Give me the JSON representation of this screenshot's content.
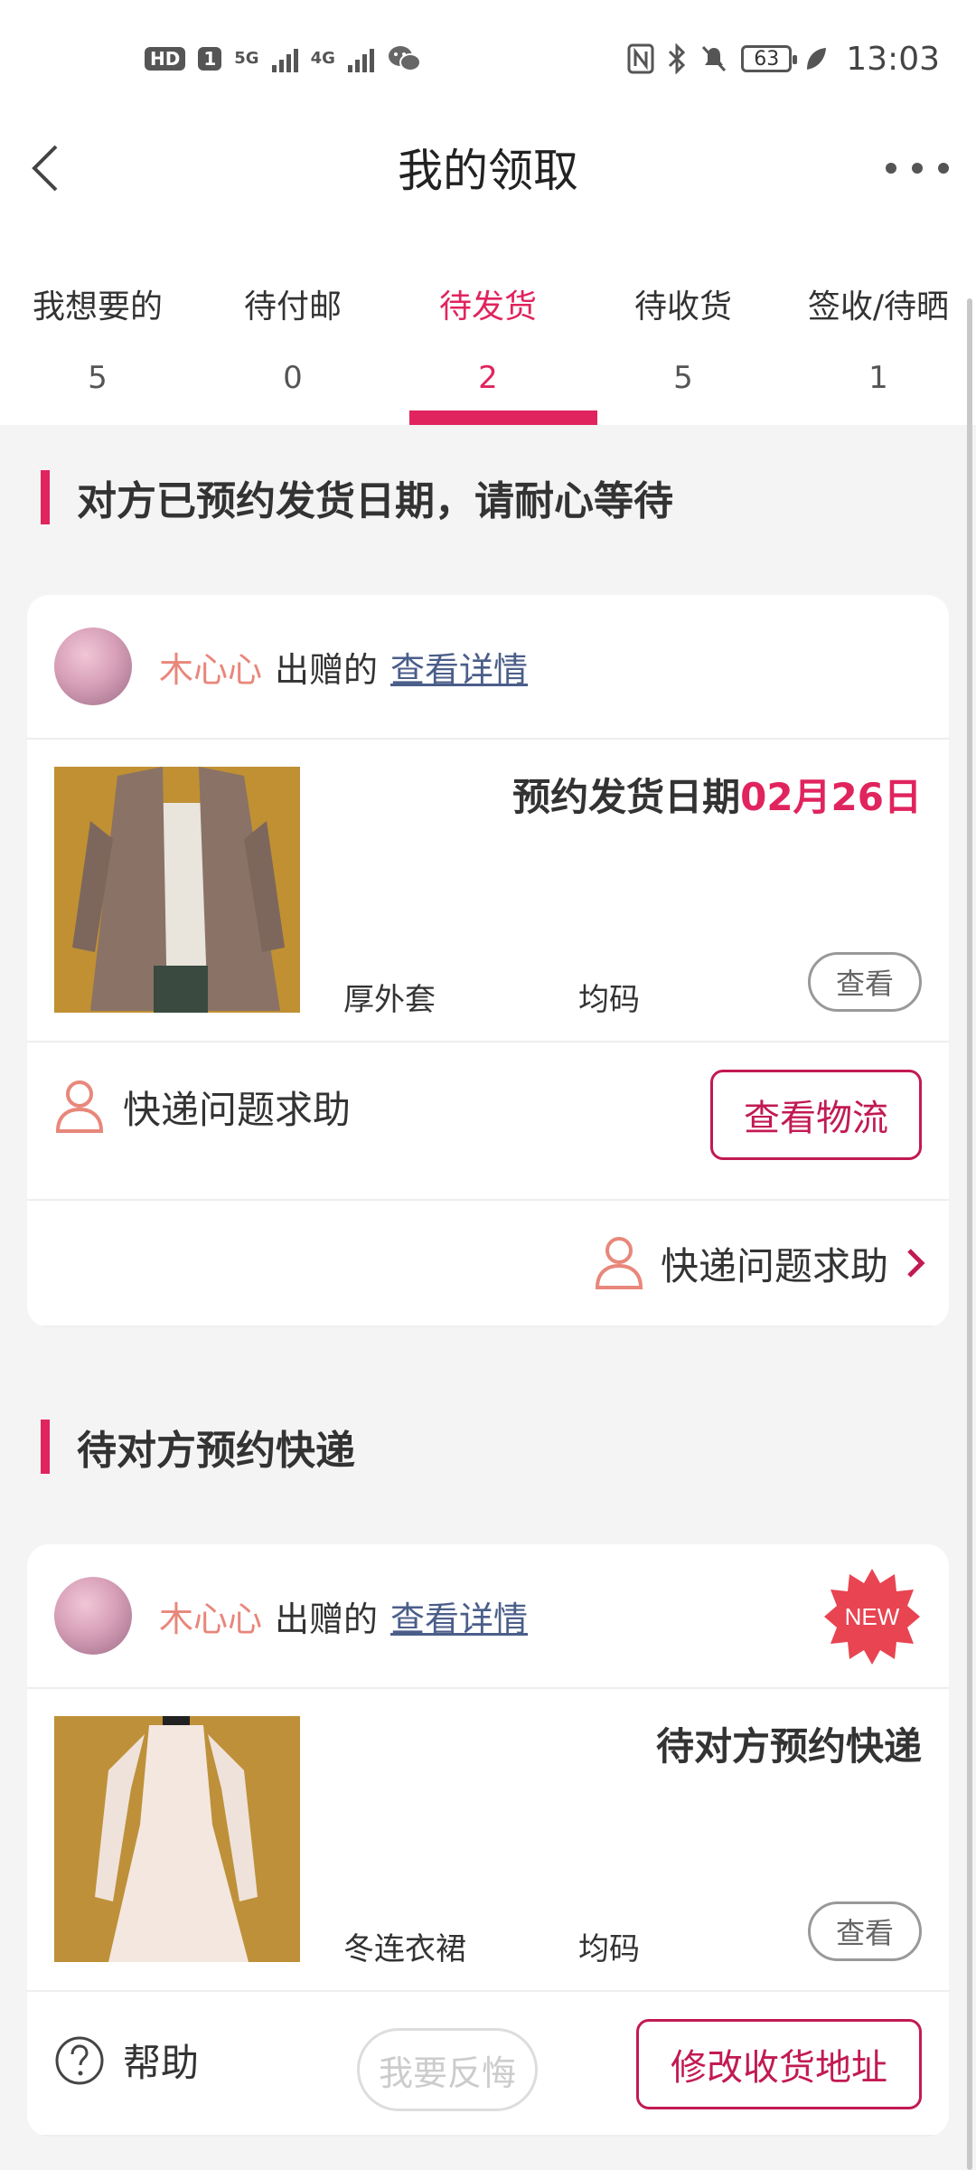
{
  "status_bar": {
    "hd": "HD",
    "sim": "1",
    "net1": "5G",
    "net2": "4G",
    "battery": "63",
    "time": "13:03"
  },
  "header": {
    "title": "我的领取"
  },
  "tabs": [
    {
      "label": "我想要的",
      "count": "5"
    },
    {
      "label": "待付邮",
      "count": "0"
    },
    {
      "label": "待发货",
      "count": "2"
    },
    {
      "label": "待收货",
      "count": "5"
    },
    {
      "label": "签收/待晒",
      "count": "1"
    }
  ],
  "sections": [
    {
      "heading": "对方已预约发货日期，请耐心等待",
      "card": {
        "giver_name": "木心心",
        "giver_text": "出赠的",
        "detail_link": "查看详情",
        "status_prefix": "预约发货日期",
        "status_date": "02月26日",
        "item_name": "厚外套",
        "item_size": "均码",
        "view_label": "查看",
        "help_label": "快递问题求助",
        "logistics_button": "查看物流",
        "footer_help_label": "快递问题求助"
      }
    },
    {
      "heading": "待对方预约快递",
      "card": {
        "giver_name": "木心心",
        "giver_text": "出赠的",
        "detail_link": "查看详情",
        "new_badge": "NEW",
        "status_text": "待对方预约快递",
        "item_name": "冬连衣裙",
        "item_size": "均码",
        "view_label": "查看",
        "help_label": "帮助",
        "regret_button": "我要反悔",
        "address_button": "修改收货地址"
      }
    }
  ],
  "colors": {
    "accent": "#e0245e",
    "button_outline": "#c21a52",
    "giver_name": "#e8877b",
    "link": "#4b5e8a"
  }
}
